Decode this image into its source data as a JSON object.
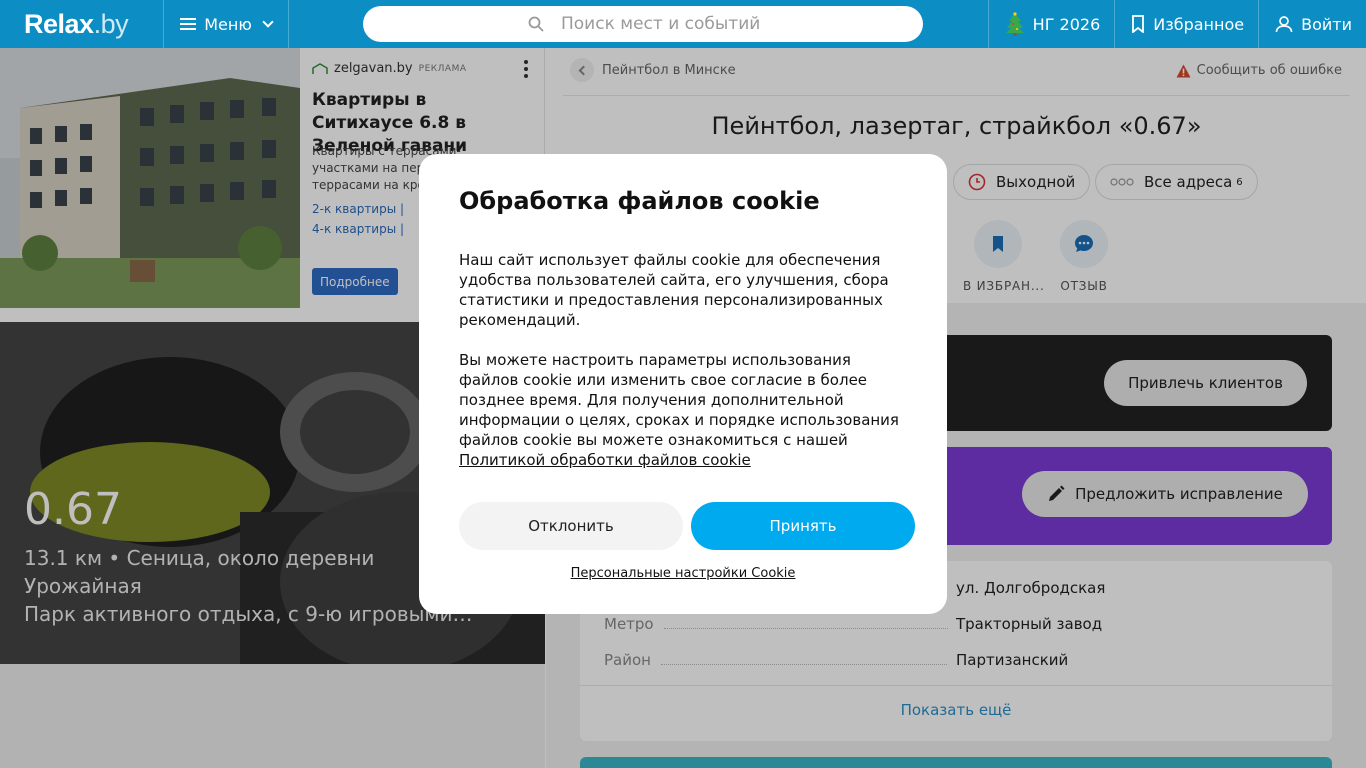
{
  "header": {
    "logo": "Relax",
    "logo_suffix": ".by",
    "menu_label": "Меню",
    "search_placeholder": "Поиск мест и событий",
    "ny_label": "НГ 2026",
    "favorites_label": "Избранное",
    "login_label": "Войти",
    "colors": {
      "bar": "#0c8ec5"
    }
  },
  "ad": {
    "source": "zelgavan.by",
    "tag": "РЕКЛАМА",
    "title": "Квартиры в Ситихаусе 6.8 в Зеленой гавани",
    "description": "Квартиры с террасами-участками на первом этаже и террасами на кро",
    "link1": "2-к квартиры   |",
    "link2": "4-к квартиры   |",
    "button": "Подробнее"
  },
  "hero": {
    "name": "0.67",
    "line1": "13.1 км • Сеница, около деревни",
    "line2": "Урожайная",
    "line3": "Парк активного отдыха, с 9-ю игровыми…"
  },
  "main": {
    "breadcrumb": "Пейнтбол в Минске",
    "report": "Сообщить об ошибке",
    "title": "Пейнтбол, лазертаг, страйкбол «0.67»",
    "chip_closed": "Выходной",
    "chip_all": "Все адреса",
    "chip_all_count": "6",
    "action_fav": "В ИЗБРАН...",
    "action_review": "ОТЗЫВ",
    "btn_attract": "Привлечь клиентов",
    "btn_suggest": "Предложить исправление",
    "info": [
      {
        "key": "",
        "value": "ул. Долгобродская"
      },
      {
        "key": "Метро",
        "value": "Тракторный завод"
      },
      {
        "key": "Район",
        "value": "Партизанский"
      }
    ],
    "show_more": "Показать ещё"
  },
  "cookie": {
    "title": "Обработка файлов cookie",
    "p1": "Наш сайт использует файлы cookie для обеспечения удобства пользователей сайта, его улучшения, сбора статистики и предоставления персонализированных рекомендаций.",
    "p2": "Вы можете настроить параметры использования файлов cookie или изменить свое согласие в более позднее время. Для получения дополнительной информации о целях, сроках и порядке использования файлов cookie вы можете ознакомиться с нашей",
    "policy_link": "Политикой обработки файлов cookie",
    "decline": "Отклонить",
    "accept": "Принять",
    "personal": "Персональные настройки Cookie",
    "colors": {
      "accept": "#00aaee"
    }
  }
}
